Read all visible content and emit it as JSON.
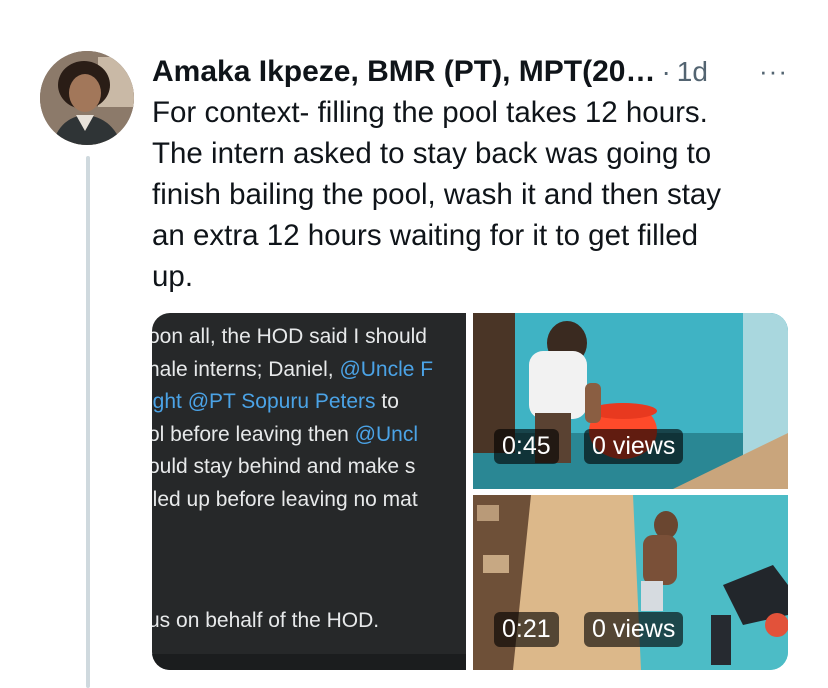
{
  "tweet": {
    "author": "Amaka Ikpeze, BMR (PT), MPT(20…",
    "separator": "·",
    "time": "1d",
    "more": "···",
    "text_lines": [
      "For context- filling the pool takes 12 hours.",
      "The intern asked to stay back was going to",
      "finish bailing the pool, wash it and then stay",
      "an extra 12 hours waiting for it to get filled",
      "up."
    ]
  },
  "media": {
    "screenshot": {
      "lines": [
        {
          "before": "oon all, the HOD said I should",
          "mention": "",
          "after": ""
        },
        {
          "before": "nale interns; Daniel, ",
          "mention": "@Uncle F",
          "after": ""
        },
        {
          "before": "",
          "mention": "ight @PT Sopuru Peters",
          "after": "  to"
        },
        {
          "before": "ol before leaving then ",
          "mention": "@Uncl",
          "after": ""
        },
        {
          "before": "ould stay behind and make s",
          "mention": "",
          "after": ""
        },
        {
          "before": "lled up before leaving no mat",
          "mention": "",
          "after": ""
        }
      ],
      "footer": "us on behalf of the HOD."
    },
    "video_1": {
      "duration": "0:45",
      "views": "0 views"
    },
    "video_2": {
      "duration": "0:21",
      "views": "0 views"
    }
  },
  "colors": {
    "mention": "#4ba3e6",
    "muted": "#536471",
    "thread_line": "#cfd9de"
  },
  "icons": [
    "more-icon"
  ]
}
